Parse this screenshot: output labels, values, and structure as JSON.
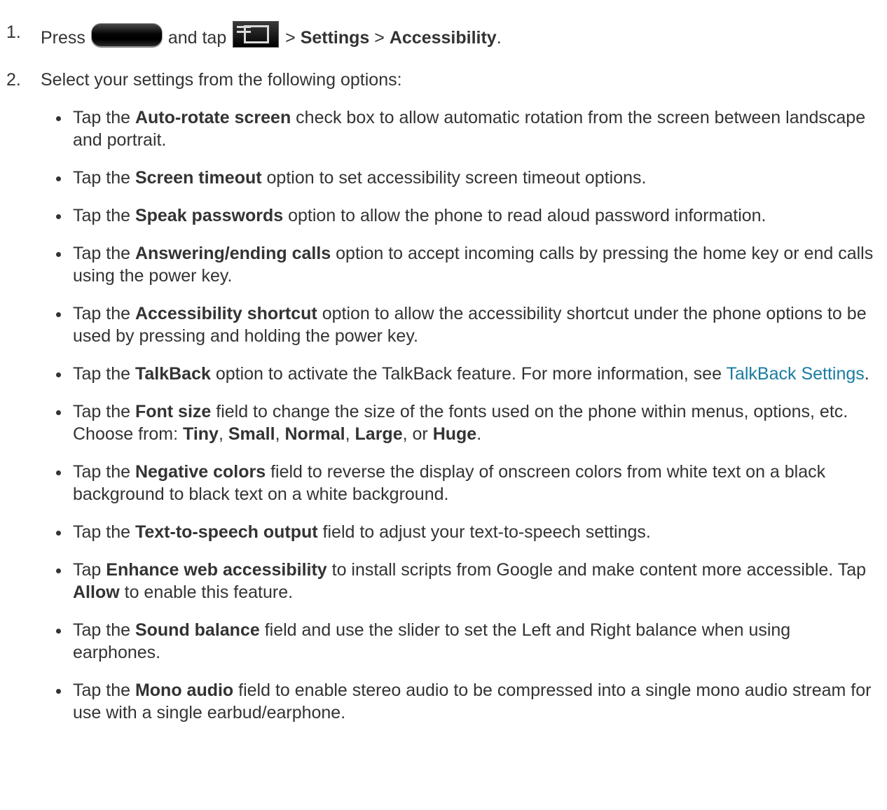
{
  "step1": {
    "number": "1.",
    "press": "Press",
    "and_tap": "and tap",
    "sep1": ">",
    "settings": "Settings",
    "sep2": ">",
    "accessibility": "Accessibility",
    "end": ".",
    "home_key_icon": "home-key-icon",
    "menu_key_icon": "menu-key-icon"
  },
  "step2": {
    "number": "2.",
    "text": "Select your settings from the following options:"
  },
  "options": [
    {
      "pre": "Tap the ",
      "bold": "Auto-rotate screen",
      "post": " check box to allow automatic rotation from the screen between landscape and portrait."
    },
    {
      "pre": "Tap the ",
      "bold": "Screen timeout",
      "post": " option to set accessibility screen timeout options."
    },
    {
      "pre": "Tap the ",
      "bold": "Speak passwords",
      "post": " option to allow the phone to read aloud password information."
    },
    {
      "pre": "Tap the ",
      "bold": "Answering/ending calls",
      "post": " option to accept incoming calls by pressing the home key or end calls using the power key."
    },
    {
      "pre": "Tap the ",
      "bold": "Accessibility shortcut",
      "post": " option to allow the accessibility shortcut under the phone options to be used by pressing and holding the power key."
    },
    {
      "pre": "Tap the ",
      "bold": "TalkBack",
      "post": " option to activate the TalkBack feature. For more information, see ",
      "link": "TalkBack Settings",
      "tail": "."
    },
    {
      "pre": "Tap the ",
      "bold": "Font size",
      "post": " field to change the size of the fonts used on the phone within menus, options, etc. Choose from: ",
      "c1": "Tiny",
      "s1": ", ",
      "c2": "Small",
      "s2": ", ",
      "c3": "Normal",
      "s3": ", ",
      "c4": "Large",
      "s4": ", or ",
      "c5": "Huge",
      "tail": "."
    },
    {
      "pre": "Tap the ",
      "bold": "Negative colors",
      "post": " field to reverse the display of onscreen colors from white text on a black background to black text on a white background."
    },
    {
      "pre": "Tap the ",
      "bold": "Text-to-speech output",
      "post": " field to adjust your text-to-speech settings."
    },
    {
      "pre": "Tap ",
      "bold": "Enhance web accessibility",
      "post": " to install scripts from Google and make content more accessible. Tap ",
      "bold2": "Allow",
      "tail": " to enable this feature."
    },
    {
      "pre": "Tap the ",
      "bold": "Sound balance",
      "post": " field and use the slider to set the Left and Right balance when using earphones."
    },
    {
      "pre": "Tap the ",
      "bold": "Mono audio",
      "post": " field to enable stereo audio to be compressed into a single mono audio stream for use with a single earbud/earphone."
    }
  ],
  "colors": {
    "text": "#333333",
    "link": "#1a7ca0"
  }
}
